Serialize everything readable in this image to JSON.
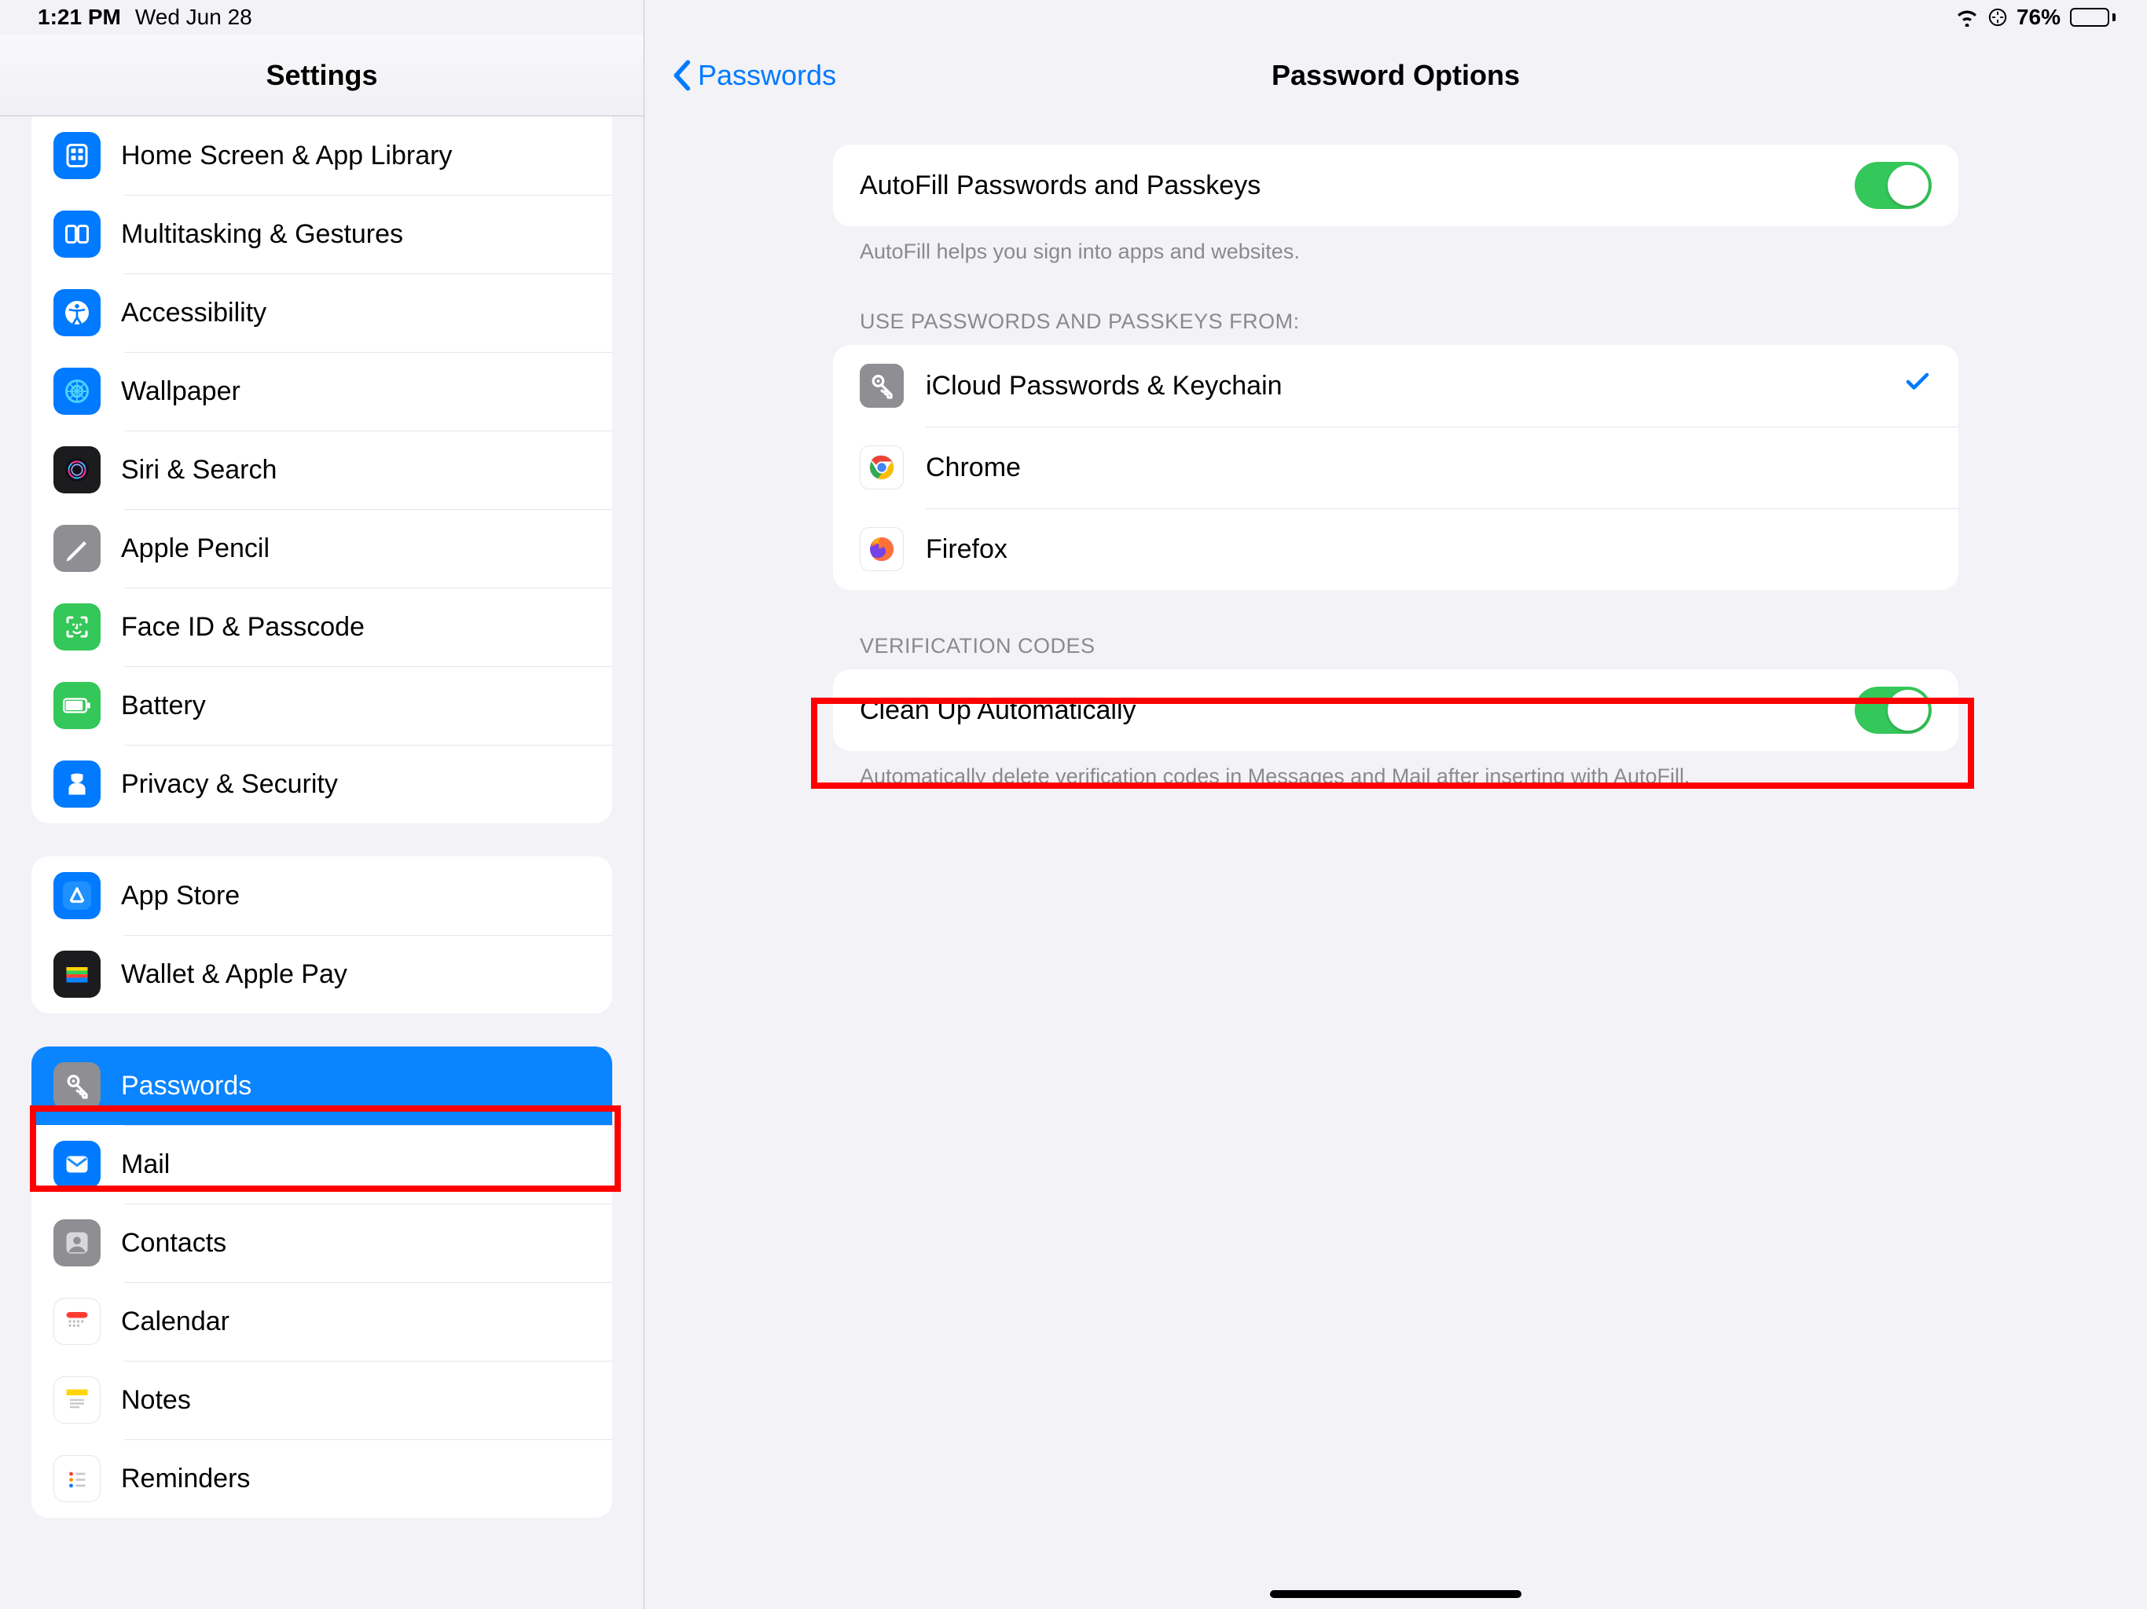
{
  "status": {
    "time": "1:21 PM",
    "date": "Wed Jun 28",
    "battery_pct": "76%"
  },
  "sidebar": {
    "title": "Settings",
    "groups": [
      {
        "items": [
          {
            "label": "Home Screen & App Library",
            "icon": "home-screen-icon",
            "bg": "bg-blue"
          },
          {
            "label": "Multitasking & Gestures",
            "icon": "multitasking-icon",
            "bg": "bg-blue"
          },
          {
            "label": "Accessibility",
            "icon": "accessibility-icon",
            "bg": "bg-blue"
          },
          {
            "label": "Wallpaper",
            "icon": "wallpaper-icon",
            "bg": "bg-blue",
            "iconColor": "#28c3ff"
          },
          {
            "label": "Siri & Search",
            "icon": "siri-icon",
            "bg": "bg-black"
          },
          {
            "label": "Apple Pencil",
            "icon": "pencil-icon",
            "bg": "bg-gray"
          },
          {
            "label": "Face ID & Passcode",
            "icon": "faceid-icon",
            "bg": "bg-green"
          },
          {
            "label": "Battery",
            "icon": "battery-icon",
            "bg": "bg-green"
          },
          {
            "label": "Privacy & Security",
            "icon": "privacy-icon",
            "bg": "bg-blue"
          }
        ]
      },
      {
        "items": [
          {
            "label": "App Store",
            "icon": "appstore-icon",
            "bg": "bg-blue"
          },
          {
            "label": "Wallet & Apple Pay",
            "icon": "wallet-icon",
            "bg": "bg-black"
          }
        ]
      },
      {
        "items": [
          {
            "label": "Passwords",
            "icon": "key-icon",
            "bg": "bg-gray",
            "selected": true
          },
          {
            "label": "Mail",
            "icon": "mail-icon",
            "bg": "bg-blue"
          },
          {
            "label": "Contacts",
            "icon": "contacts-icon",
            "bg": "bg-gray"
          },
          {
            "label": "Calendar",
            "icon": "calendar-icon",
            "bg": "bg-white"
          },
          {
            "label": "Notes",
            "icon": "notes-icon",
            "bg": "bg-white"
          },
          {
            "label": "Reminders",
            "icon": "reminders-icon",
            "bg": "bg-white"
          }
        ]
      }
    ]
  },
  "detail": {
    "back_label": "Passwords",
    "title": "Password Options",
    "sections": [
      {
        "rows": [
          {
            "label": "AutoFill Passwords and Passkeys",
            "toggle": true,
            "on": true
          }
        ],
        "footer": "AutoFill helps you sign into apps and websites."
      },
      {
        "header": "USE PASSWORDS AND PASSKEYS FROM:",
        "rows": [
          {
            "label": "iCloud Passwords & Keychain",
            "icon": "key-icon",
            "bg": "bg-gray",
            "checked": true
          },
          {
            "label": "Chrome",
            "icon": "chrome-icon",
            "bg": "bg-white"
          },
          {
            "label": "Firefox",
            "icon": "firefox-icon",
            "bg": "bg-white"
          }
        ]
      },
      {
        "header": "VERIFICATION CODES",
        "rows": [
          {
            "label": "Clean Up Automatically",
            "toggle": true,
            "on": true,
            "highlight": true
          }
        ],
        "footer": "Automatically delete verification codes in Messages and Mail after inserting with AutoFill."
      }
    ]
  }
}
